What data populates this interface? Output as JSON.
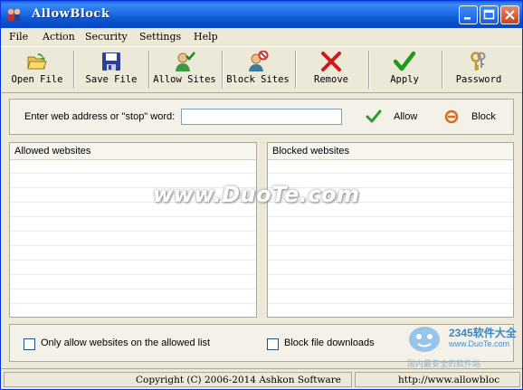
{
  "window": {
    "title": "AllowBlock"
  },
  "menu": [
    "File",
    "Action",
    "Security",
    "Settings",
    "Help"
  ],
  "toolbar": {
    "open": "Open File",
    "save": "Save File",
    "allow_sites": "Allow Sites",
    "block_sites": "Block Sites",
    "remove": "Remove",
    "apply": "Apply",
    "password": "Password"
  },
  "input_area": {
    "prompt": "Enter web address or \"stop\" word:",
    "value": "",
    "allow": "Allow",
    "block": "Block"
  },
  "lists": {
    "allowed_header": "Allowed websites",
    "blocked_header": "Blocked websites",
    "allowed": [],
    "blocked": []
  },
  "options": {
    "only_allow": "Only allow websites on the allowed list",
    "only_allow_checked": false,
    "block_downloads": "Block file downloads",
    "block_downloads_checked": false
  },
  "status": {
    "copyright": "Copyright (C) 2006-2014 Ashkon Software",
    "url": "http://www.allowbloc"
  },
  "watermarks": {
    "center": "www.DuoTe.com",
    "brand": "2345软件大全",
    "site": "www.DuoTe.com",
    "tag": "国内最安全的软件站"
  },
  "colors": {
    "titlebar": "#0a55d0",
    "face": "#ece9d8",
    "allow_green": "#2e9a2e",
    "block_orange": "#e06a1a"
  }
}
